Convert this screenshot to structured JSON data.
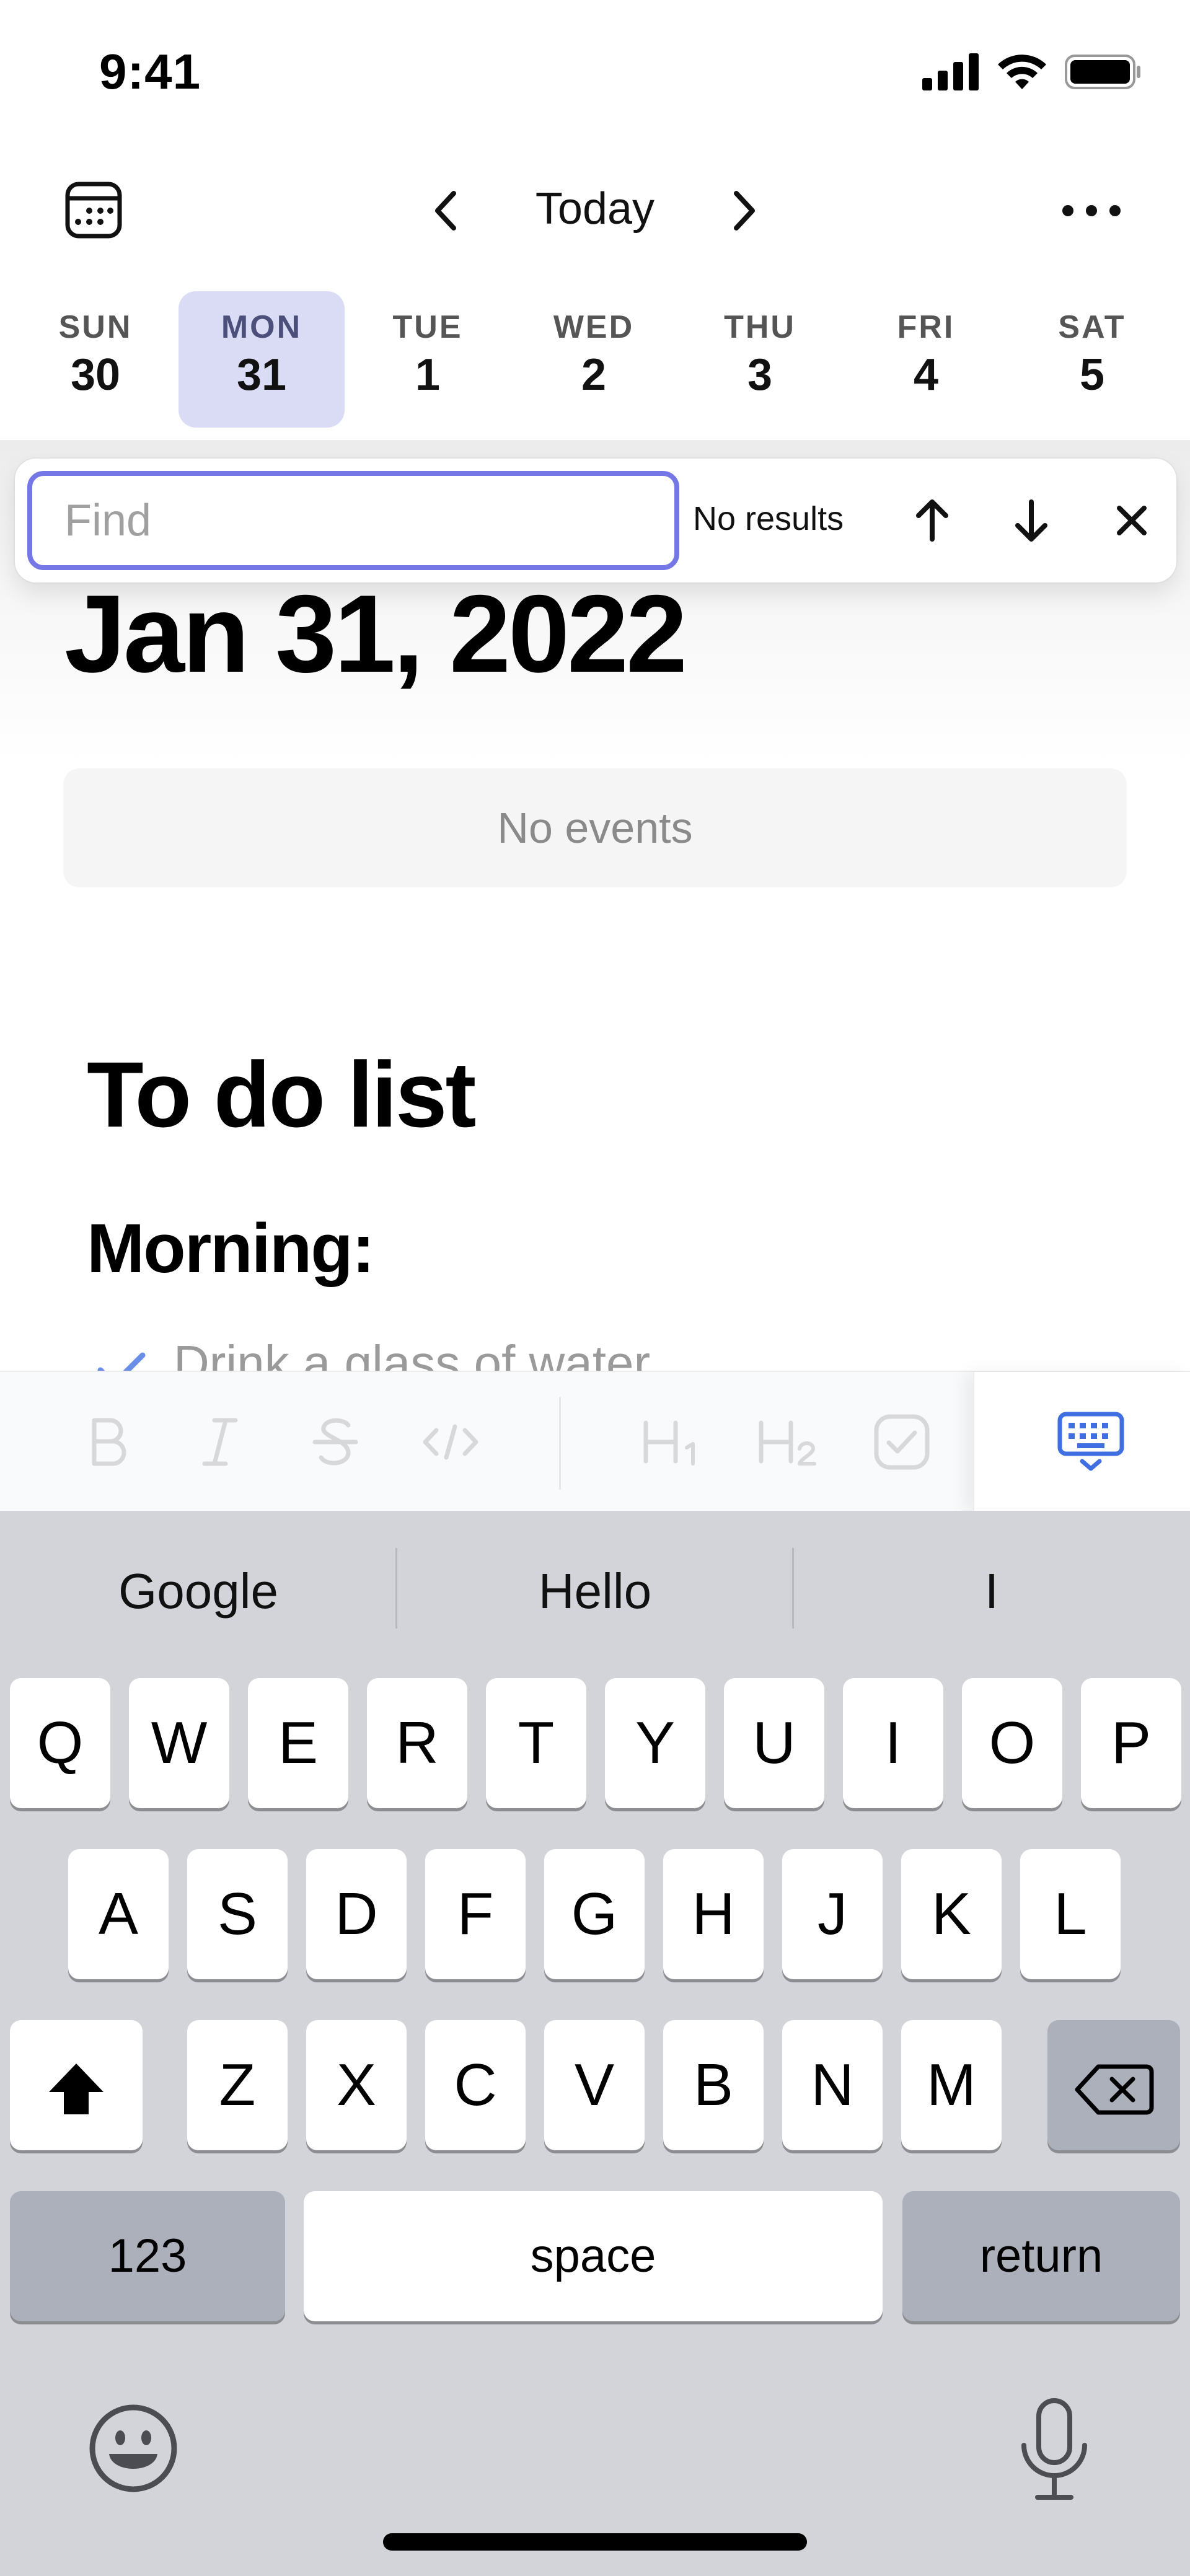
{
  "status_bar": {
    "time": "9:41"
  },
  "header": {
    "title": "Today"
  },
  "week": [
    {
      "name": "SUN",
      "num": "30"
    },
    {
      "name": "MON",
      "num": "31",
      "selected": true
    },
    {
      "name": "TUE",
      "num": "1"
    },
    {
      "name": "WED",
      "num": "2"
    },
    {
      "name": "THU",
      "num": "3"
    },
    {
      "name": "FRI",
      "num": "4"
    },
    {
      "name": "SAT",
      "num": "5"
    }
  ],
  "find": {
    "placeholder": "Find",
    "value": "",
    "status": "No results"
  },
  "content": {
    "date_heading": "Jan 31, 2022",
    "no_events": "No events",
    "todo_title": "To do list",
    "section_heading": "Morning:",
    "items": [
      {
        "text": "Drink a glass of water",
        "checked": true
      }
    ]
  },
  "toolbar": {
    "icons": [
      "bold-icon",
      "italic-icon",
      "strikethrough-icon",
      "code-icon",
      "heading-1-icon",
      "heading-2-icon",
      "checkbox-icon",
      "keyboard-hide-icon"
    ]
  },
  "keyboard": {
    "suggestions": [
      "Google",
      "Hello",
      "I"
    ],
    "row1": [
      "Q",
      "W",
      "E",
      "R",
      "T",
      "Y",
      "U",
      "I",
      "O",
      "P"
    ],
    "row2": [
      "A",
      "S",
      "D",
      "F",
      "G",
      "H",
      "J",
      "K",
      "L"
    ],
    "row3": [
      "Z",
      "X",
      "C",
      "V",
      "B",
      "N",
      "M"
    ],
    "numbers_label": "123",
    "space_label": "space",
    "return_label": "return"
  },
  "colors": {
    "accent": "#7577e6",
    "selected_day": "#dadcf6",
    "check": "#6a8ee8",
    "keyboard_bg": "#d2d4da"
  }
}
